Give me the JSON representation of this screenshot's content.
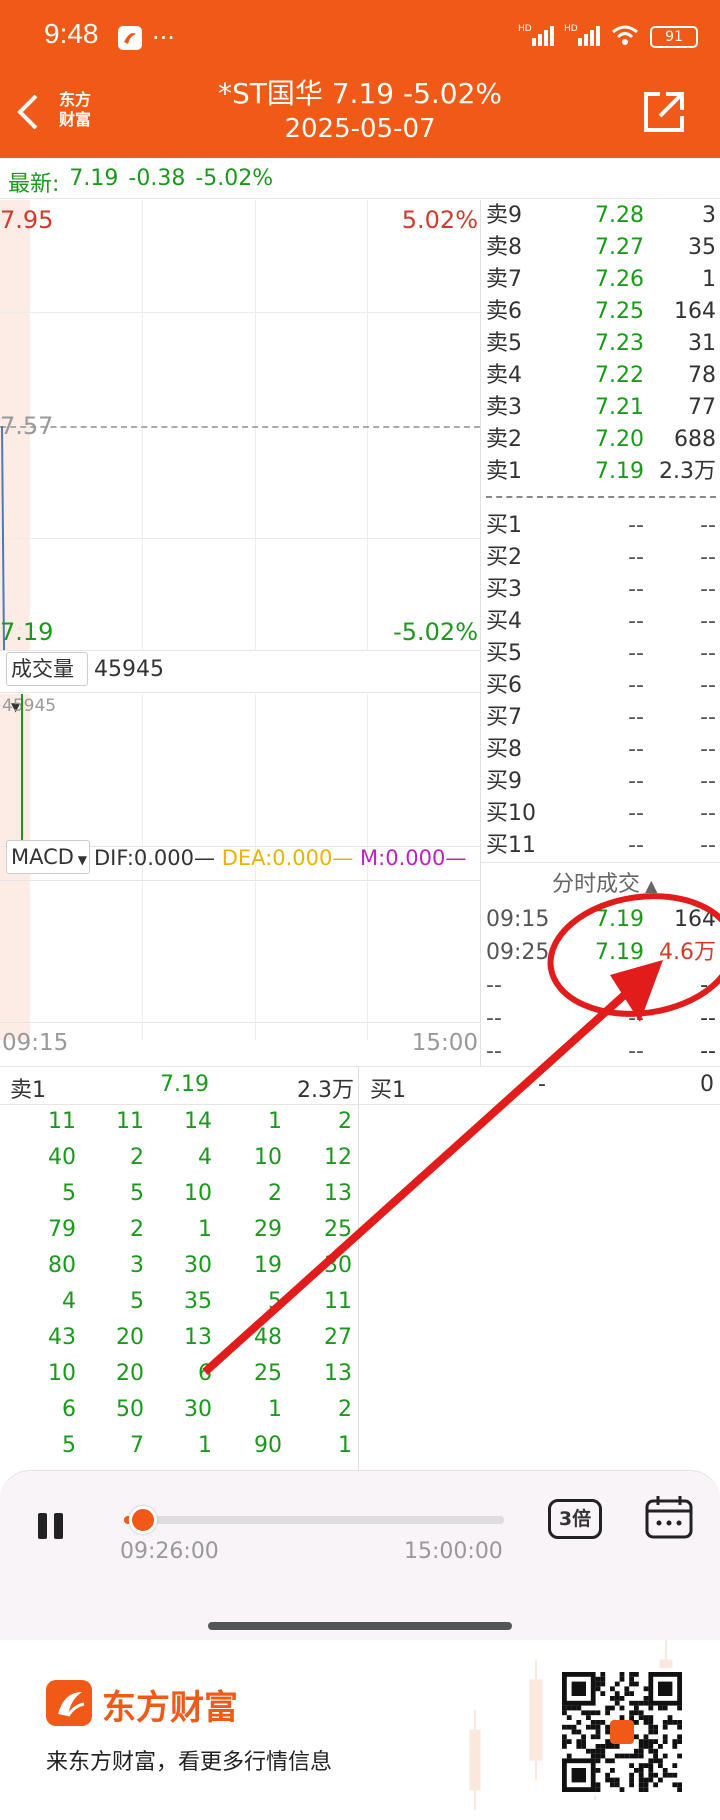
{
  "status_bar": {
    "time": "9:48",
    "battery": "91"
  },
  "nav": {
    "title": "*ST国华  7.19  -5.02%",
    "date": "2025-05-07",
    "logo_line1": "东方",
    "logo_line2": "财富"
  },
  "quote": {
    "label": "最新:",
    "price": "7.19",
    "change": "-0.38",
    "pct": "-5.02%"
  },
  "chart": {
    "price_high": "7.95",
    "pct_high": "5.02%",
    "price_mid": "7.57",
    "price_low": "7.19",
    "pct_low": "-5.02%",
    "volume_label": "成交量",
    "volume_value": "45945",
    "volume_axis": "45945",
    "macd_label": "MACD",
    "dif": "DIF:0.000",
    "dea": "DEA:0.000",
    "m": "M:0.000",
    "time_start": "09:15",
    "time_end": "15:00"
  },
  "orderbook": {
    "sells": [
      {
        "label": "卖9",
        "price": "7.28",
        "vol": "3"
      },
      {
        "label": "卖8",
        "price": "7.27",
        "vol": "35"
      },
      {
        "label": "卖7",
        "price": "7.26",
        "vol": "1"
      },
      {
        "label": "卖6",
        "price": "7.25",
        "vol": "164"
      },
      {
        "label": "卖5",
        "price": "7.23",
        "vol": "31"
      },
      {
        "label": "卖4",
        "price": "7.22",
        "vol": "78"
      },
      {
        "label": "卖3",
        "price": "7.21",
        "vol": "77"
      },
      {
        "label": "卖2",
        "price": "7.20",
        "vol": "688"
      },
      {
        "label": "卖1",
        "price": "7.19",
        "vol": "2.3万"
      }
    ],
    "buys": [
      {
        "label": "买1",
        "price": "--",
        "vol": "--"
      },
      {
        "label": "买2",
        "price": "--",
        "vol": "--"
      },
      {
        "label": "买3",
        "price": "--",
        "vol": "--"
      },
      {
        "label": "买4",
        "price": "--",
        "vol": "--"
      },
      {
        "label": "买5",
        "price": "--",
        "vol": "--"
      },
      {
        "label": "买6",
        "price": "--",
        "vol": "--"
      },
      {
        "label": "买7",
        "price": "--",
        "vol": "--"
      },
      {
        "label": "买8",
        "price": "--",
        "vol": "--"
      },
      {
        "label": "买9",
        "price": "--",
        "vol": "--"
      },
      {
        "label": "买10",
        "price": "--",
        "vol": "--"
      },
      {
        "label": "买11",
        "price": "--",
        "vol": "--"
      }
    ]
  },
  "ticks": {
    "title": "分时成交",
    "rows": [
      {
        "time": "09:15",
        "price": "7.19",
        "vol": "164"
      },
      {
        "time": "09:25",
        "price": "7.19",
        "vol": "4.6万"
      },
      {
        "time": "--",
        "price": "--",
        "vol": "--"
      },
      {
        "time": "--",
        "price": "--",
        "vol": "--"
      },
      {
        "time": "--",
        "price": "--",
        "vol": "--"
      }
    ]
  },
  "queue": {
    "sell_label": "卖1",
    "sell_price": "7.19",
    "sell_vol": "2.3万",
    "buy_label": "买1",
    "buy_price": "-",
    "buy_vol": "0",
    "rows": [
      [
        "11",
        "11",
        "14",
        "1",
        "2"
      ],
      [
        "40",
        "2",
        "4",
        "10",
        "12"
      ],
      [
        "5",
        "5",
        "10",
        "2",
        "13"
      ],
      [
        "79",
        "2",
        "1",
        "29",
        "25"
      ],
      [
        "80",
        "3",
        "30",
        "19",
        "30"
      ],
      [
        "4",
        "5",
        "35",
        "5",
        "11"
      ],
      [
        "43",
        "20",
        "13",
        "48",
        "27"
      ],
      [
        "10",
        "20",
        "6",
        "25",
        "13"
      ],
      [
        "6",
        "50",
        "30",
        "1",
        "2"
      ],
      [
        "5",
        "7",
        "1",
        "90",
        "1"
      ]
    ]
  },
  "player": {
    "start_time": "09:26:00",
    "end_time": "15:00:00",
    "speed": "3倍",
    "progress": 0.05
  },
  "footer": {
    "brand": "东方财富",
    "slogan": "来东方财富，看更多行情信息"
  },
  "colors": {
    "brand": "#F15A16",
    "up": "#d43a2a",
    "down": "#1a9a1a",
    "annotation": "#e21b1b"
  }
}
